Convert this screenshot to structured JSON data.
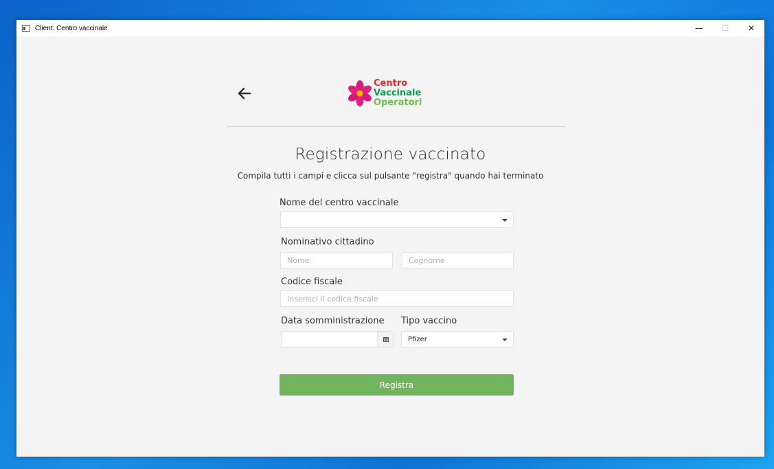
{
  "window": {
    "title": "Client: Centro vaccinale"
  },
  "logo": {
    "line1": "Centro",
    "line2": "Vaccinale",
    "line3": "Operatori"
  },
  "page": {
    "title": "Registrazione vaccinato",
    "subtitle": "Compila tutti i campi e clicca sul pulsante \"registra\" quando hai terminato"
  },
  "form": {
    "centro_label": "Nome del centro vaccinale",
    "centro_value": "",
    "nominativo_label": "Nominativo cittadino",
    "nome_placeholder": "Nome",
    "cognome_placeholder": "Cognome",
    "cf_label": "Codice fiscale",
    "cf_placeholder": "Inserisci il codice fiscale",
    "data_label": "Data somministrazione",
    "data_value": "",
    "tipo_label": "Tipo vaccino",
    "tipo_value": "Pfizer",
    "register_label": "Registra"
  },
  "colors": {
    "accent": "#72b45d",
    "logo_red": "#e8262c",
    "logo_green": "#0e9a4d",
    "logo_light_green": "#6cbf4a",
    "flower": "#d81b7a"
  },
  "icons": [
    "app-window-icon",
    "back-arrow-icon",
    "flower-logo-icon",
    "chevron-down-icon",
    "calendar-icon",
    "minimize-icon",
    "maximize-icon",
    "close-icon"
  ]
}
